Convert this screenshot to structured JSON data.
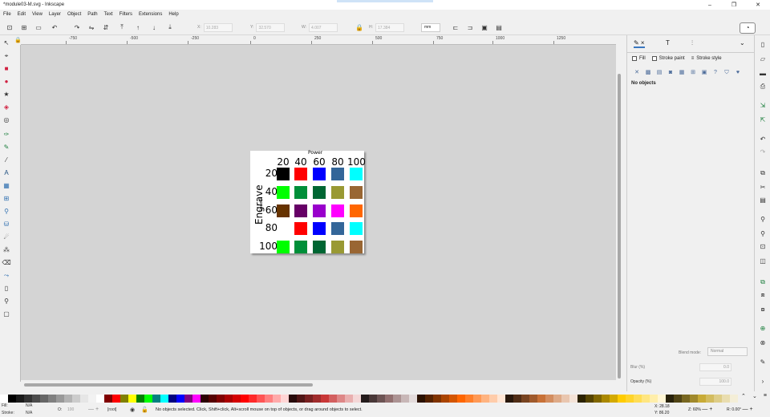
{
  "window": {
    "title": "*module03-M.svg - Inkscape",
    "buttons": [
      "–",
      "❐",
      "✕"
    ]
  },
  "menu": [
    "File",
    "Edit",
    "View",
    "Layer",
    "Object",
    "Path",
    "Text",
    "Filters",
    "Extensions",
    "Help"
  ],
  "toolbar": {
    "x_label": "X:",
    "x_value": "10.283",
    "y_label": "Y:",
    "y_value": "32.570",
    "w_label": "W:",
    "w_value": "4.007",
    "h_label": "H:",
    "h_value": "17.384",
    "units": "mm"
  },
  "ruler": {
    "ticks": [
      "-750",
      "-500",
      "-250",
      "0",
      "250",
      "500",
      "750",
      "1000",
      "1250"
    ]
  },
  "page": {
    "power_label": "Power",
    "speed_label": "Speed",
    "engrave_label": "Engrave",
    "col_headers": [
      "20",
      "40",
      "60",
      "80",
      "100"
    ],
    "row_headers": [
      "20",
      "40",
      "60",
      "80",
      "100"
    ],
    "grid_colors": [
      [
        "#000000",
        "#ff0000",
        "#0000ff",
        "#336699",
        "#00ffff"
      ],
      [
        "#00ff00",
        "#008f39",
        "#006633",
        "#999933",
        "#996633"
      ],
      [
        "#663300",
        "#660066",
        "#9900cc",
        "#ff00ff",
        "#ff6600"
      ],
      [
        "",
        "#ff0000",
        "#0000ff",
        "#336699",
        "#00ffff"
      ],
      [
        "#00ff00",
        "#008f39",
        "#006633",
        "#999933",
        "#996633"
      ]
    ]
  },
  "fill_panel": {
    "tabs": [
      "Fill",
      "Stroke paint",
      "Stroke style"
    ],
    "no_objects": "No objects",
    "blend_label": "Blend mode:",
    "blend_value": "Normal",
    "blur_label": "Blur (%)",
    "blur_value": "0.0",
    "opacity_label": "Opacity (%)",
    "opacity_value": "100.0"
  },
  "statusbar": {
    "fill_label": "Fill:",
    "fill_value": "N/A",
    "stroke_label": "Stroke:",
    "stroke_value": "N/A",
    "opacity_label": "O:",
    "opacity_value": "100",
    "layer": "[root]",
    "message": "No objects selected. Click, Shift+click, Alt+scroll mouse on top of objects, or drag around objects to select.",
    "x_label": "X:",
    "x_value": "28.18",
    "y_label": "Y:",
    "y_value": "86.20",
    "z_label": "Z:",
    "zoom": "60%",
    "r_label": "R:",
    "rotation": "0.00°"
  },
  "palette_colors": [
    "#ffffff",
    "#000000",
    "#1a1a1a",
    "#333333",
    "#4d4d4d",
    "#666666",
    "#808080",
    "#999999",
    "#b3b3b3",
    "#cccccc",
    "#e6e6e6",
    "#f2f2f2",
    "#ffffff",
    "#800000",
    "#ff0000",
    "#808000",
    "#ffff00",
    "#008000",
    "#00ff00",
    "#008080",
    "#00ffff",
    "#000080",
    "#0000ff",
    "#800080",
    "#ff00ff",
    "#2b0000",
    "#550000",
    "#800000",
    "#aa0000",
    "#d40000",
    "#ff0000",
    "#ff2a2a",
    "#ff5555",
    "#ff8080",
    "#ffaaaa",
    "#ffd5d5",
    "#280b0b",
    "#501616",
    "#782121",
    "#a02c2c",
    "#c83737",
    "#d35f5f",
    "#de8787",
    "#e9afaf",
    "#f4d7d7",
    "#241c1c",
    "#483737",
    "#6c5353",
    "#916f6f",
    "#ac9393",
    "#c8b7b7",
    "#e3dbdb",
    "#2b1100",
    "#552200",
    "#803300",
    "#aa4400",
    "#d45500",
    "#ff6600",
    "#ff7f2a",
    "#ff9955",
    "#ffb380",
    "#ffccaa",
    "#ffe6d5",
    "#28170b",
    "#502d16",
    "#784421",
    "#a05a2c",
    "#c87137",
    "#d38d5f",
    "#deaa87",
    "#e9c6af",
    "#f4e3d7",
    "#2b2200",
    "#554400",
    "#806600",
    "#aa8800",
    "#d4aa00",
    "#ffcc00",
    "#ffd42a",
    "#ffdd55",
    "#ffe680",
    "#ffeeaa",
    "#fff6d5",
    "#28220b",
    "#504416",
    "#786721",
    "#a0892c",
    "#c8ab37",
    "#d3bc5f",
    "#decd87",
    "#e9ddaf",
    "#f4eed7"
  ]
}
